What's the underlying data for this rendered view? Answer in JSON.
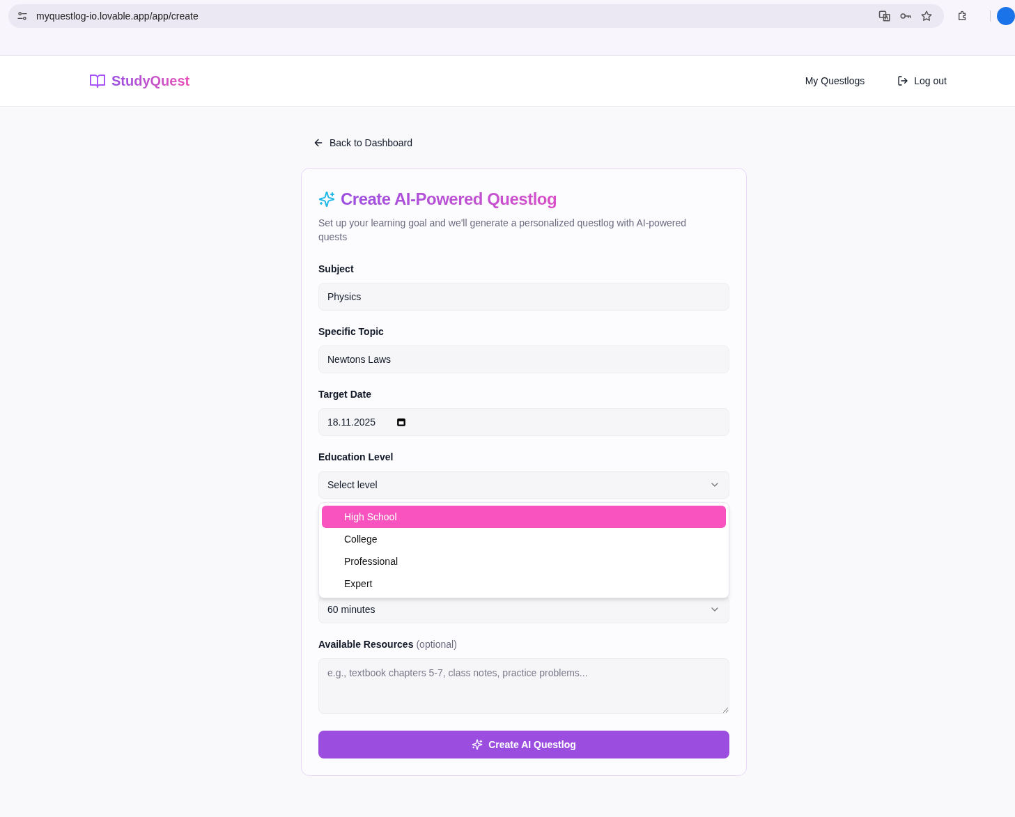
{
  "browser": {
    "url": "myquestlog-io.lovable.app/app/create"
  },
  "header": {
    "logo": "StudyQuest",
    "nav": [
      "My Questlogs",
      "Log out"
    ]
  },
  "back_link": "Back to Dashboard",
  "card": {
    "title": "Create AI-Powered Questlog",
    "subtitle": "Set up your learning goal and we'll generate a personalized questlog with AI-powered quests"
  },
  "fields": [
    {
      "kind": "text",
      "label": "Subject",
      "value": "Physics"
    },
    {
      "kind": "text",
      "label": "Specific Topic",
      "value": "Newtons Laws"
    },
    {
      "kind": "date",
      "label": "Target Date",
      "value": "18.11.2025"
    },
    {
      "kind": "select",
      "label": "Education Level",
      "value": "Select level",
      "open": true,
      "options": [
        {
          "label": "High School",
          "selected": true
        },
        {
          "label": "College",
          "selected": false
        },
        {
          "label": "Professional",
          "selected": false
        },
        {
          "label": "Expert",
          "selected": false
        }
      ]
    },
    {
      "kind": "select",
      "value": "60 minutes",
      "open": false
    },
    {
      "kind": "textarea",
      "label": "Available Resources",
      "hint": "(optional)",
      "placeholder": "e.g., textbook chapters 5-7, class notes, practice problems..."
    }
  ],
  "submit_button": "Create AI Questlog"
}
